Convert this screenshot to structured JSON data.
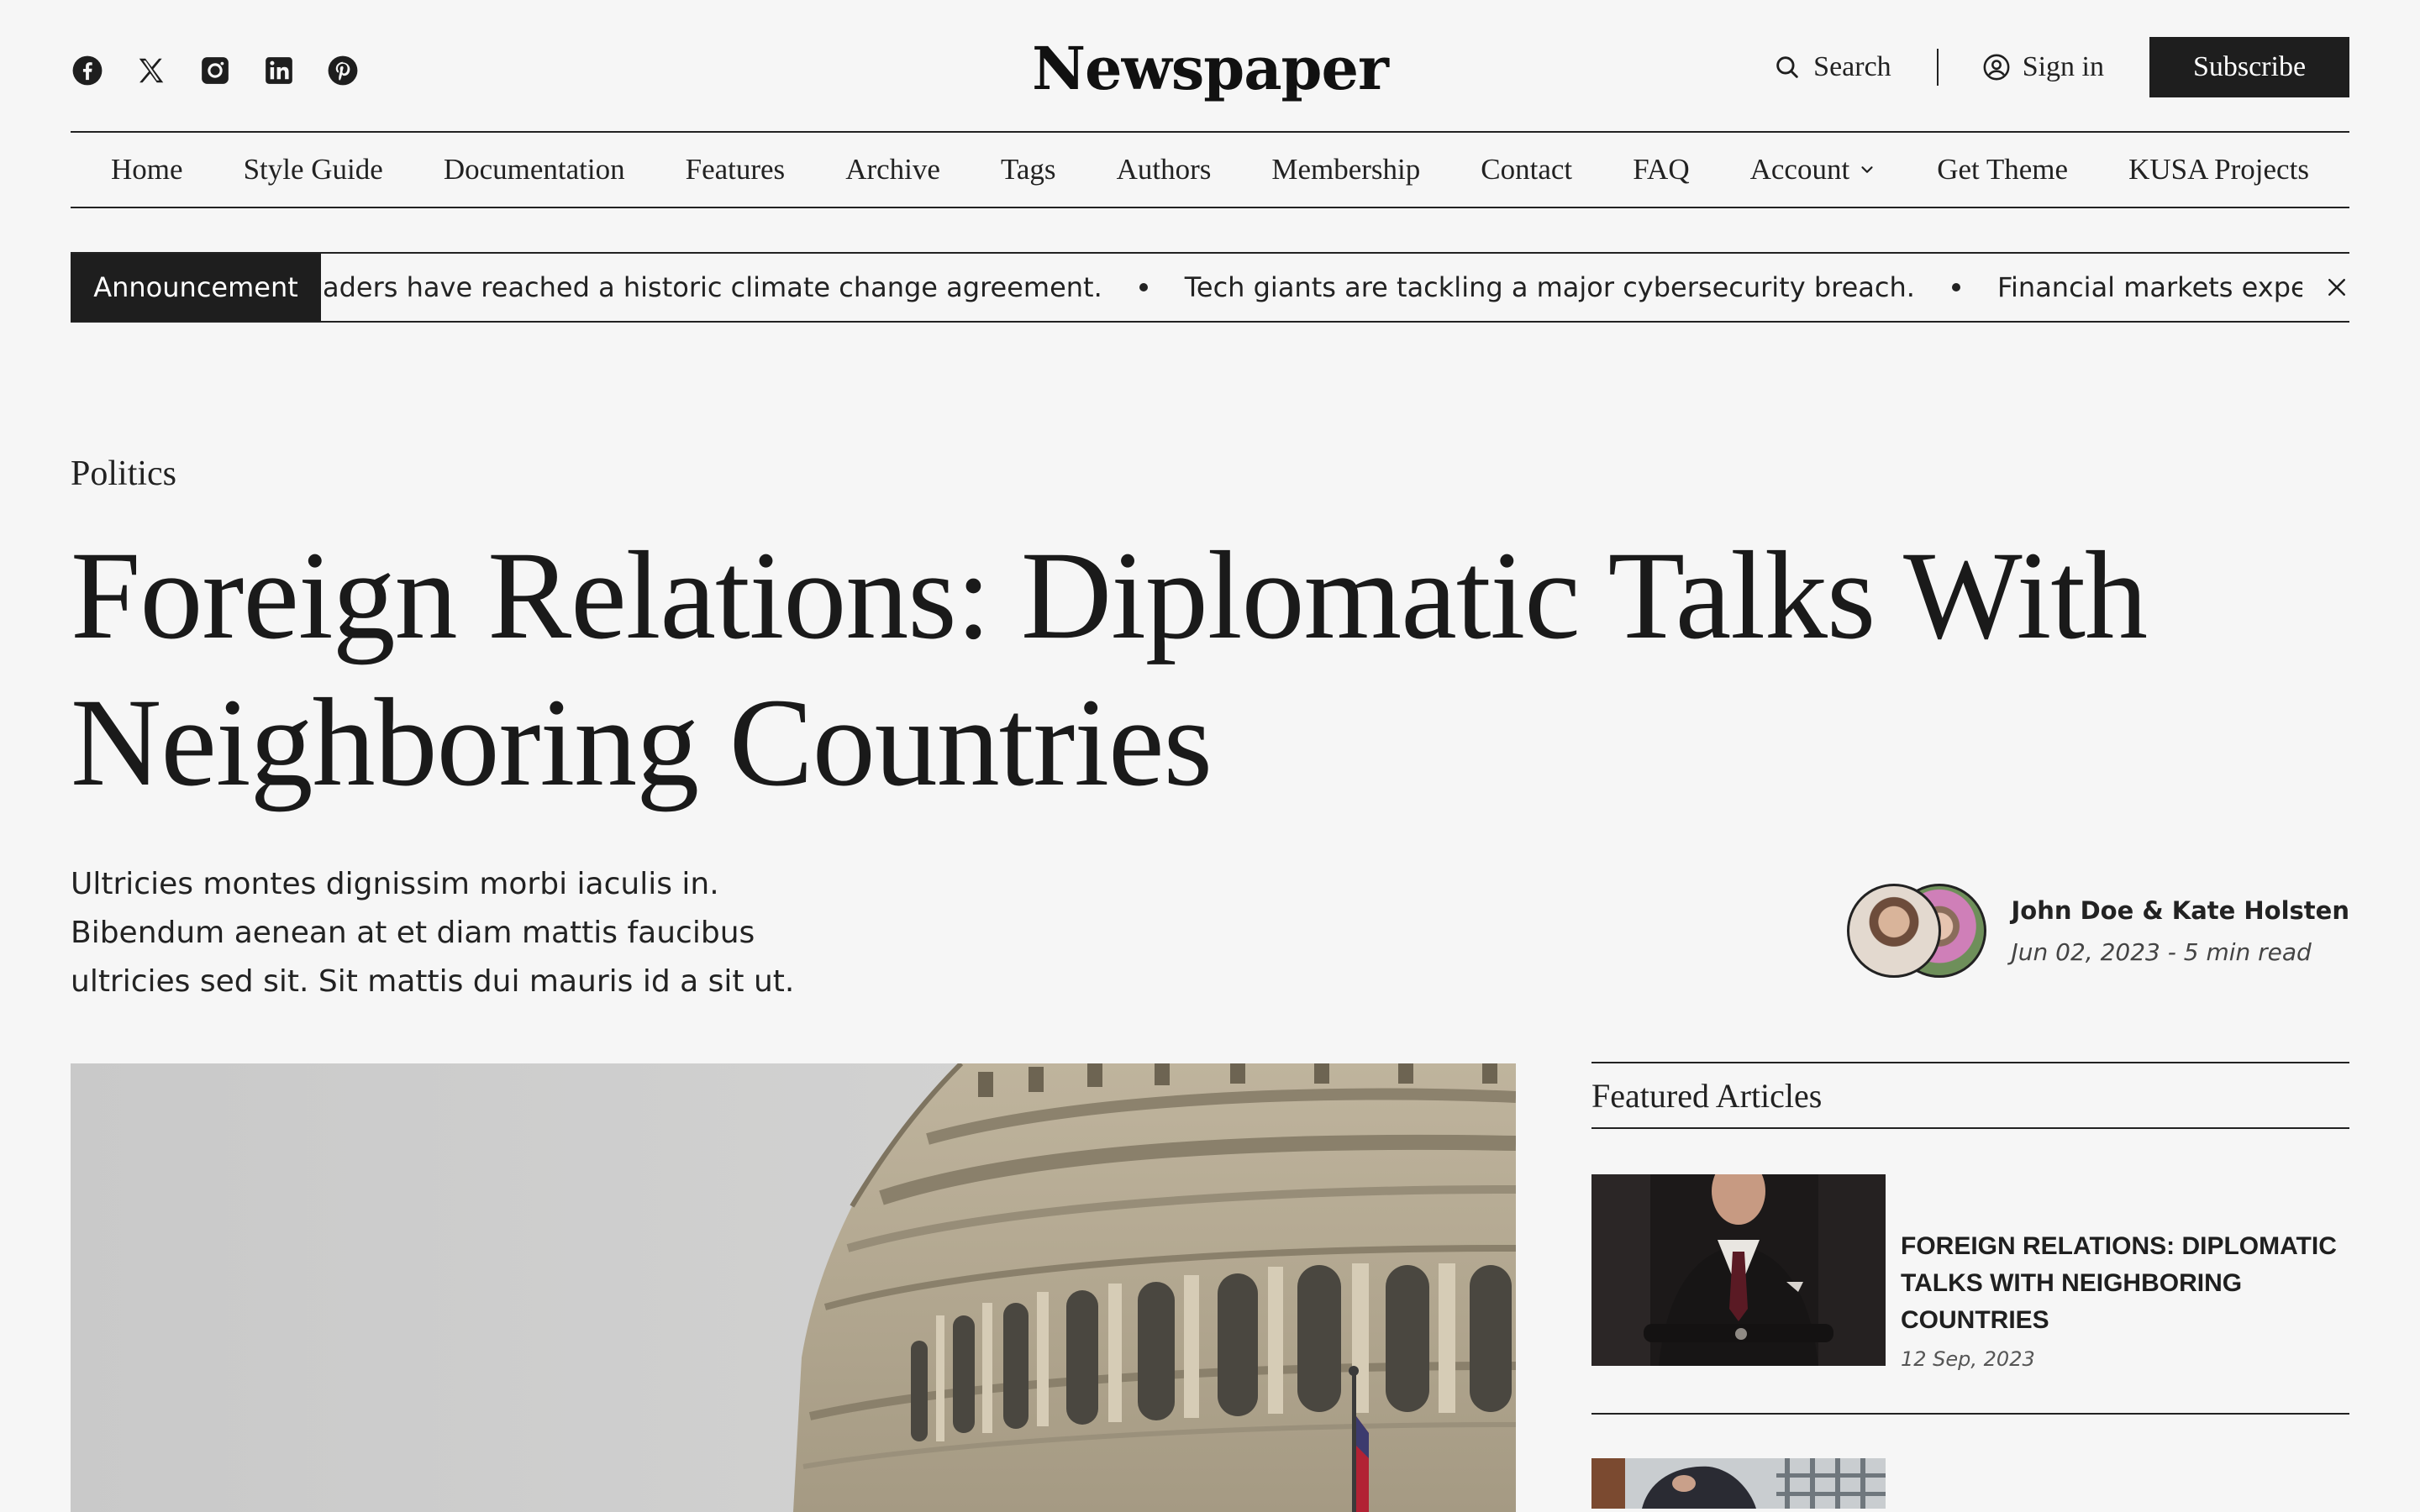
{
  "header": {
    "logo": "Newspaper",
    "socials": [
      "facebook-icon",
      "x-icon",
      "instagram-icon",
      "linkedin-icon",
      "pinterest-icon"
    ],
    "search_label": "Search",
    "signin_label": "Sign in",
    "subscribe_label": "Subscribe"
  },
  "nav": {
    "items": [
      {
        "label": "Home"
      },
      {
        "label": "Style Guide"
      },
      {
        "label": "Documentation"
      },
      {
        "label": "Features"
      },
      {
        "label": "Archive"
      },
      {
        "label": "Tags"
      },
      {
        "label": "Authors"
      },
      {
        "label": "Membership"
      },
      {
        "label": "Contact"
      },
      {
        "label": "FAQ"
      },
      {
        "label": "Account"
      },
      {
        "label": "Get Theme"
      },
      {
        "label": "KUSA Projects"
      }
    ]
  },
  "announcement": {
    "label": "Announcement",
    "items": [
      "aders have reached a historic climate change agreement.",
      "Tech giants are tackling a major cybersecurity breach.",
      "Financial markets experience high v"
    ]
  },
  "article": {
    "category": "Politics",
    "title": "Foreign Relations: Diplomatic Talks With Neighboring Countries",
    "excerpt": "Ultricies montes dignissim morbi iaculis in. Bibendum aenean at et diam mattis faucibus ultricies sed sit. Sit mattis dui mauris id a sit ut.",
    "authors": "John Doe & Kate Holsten",
    "meta": "Jun 02, 2023 - 5 min read"
  },
  "sidebar": {
    "title": "Featured Articles",
    "articles": [
      {
        "title": "FOREIGN RELATIONS: DIPLOMATIC TALKS WITH NEIGHBORING COUNTRIES",
        "date": "12 Sep, 2023"
      }
    ]
  },
  "colors": {
    "background": "#f6f6f6",
    "text": "#1f1f1f",
    "button": "#1e1e1e"
  }
}
